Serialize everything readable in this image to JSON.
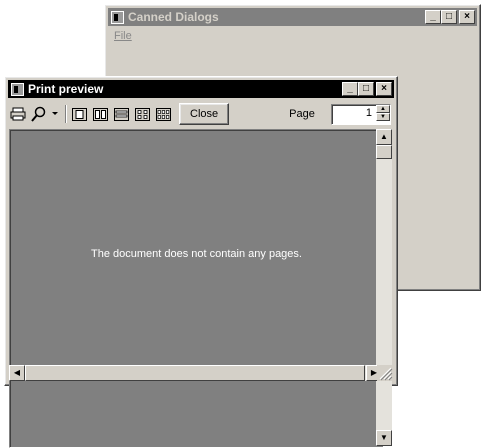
{
  "background_window": {
    "title": "Canned Dialogs",
    "menu": [
      "File"
    ],
    "caption_buttons": [
      "_",
      "□",
      "×"
    ]
  },
  "preview_window": {
    "title": "Print preview",
    "caption_buttons": [
      "_",
      "□",
      "×"
    ],
    "toolbar": {
      "icons": [
        "print-icon",
        "zoom-icon",
        "dropdown-arrow-icon",
        "one-page-icon",
        "two-pages-icon",
        "three-pages-icon",
        "four-pages-icon",
        "six-pages-icon"
      ],
      "close_label": "Close",
      "page_label": "Page",
      "page_value": "1"
    },
    "message": "The document does not contain any pages."
  },
  "colors": {
    "desktop": "#ffffff",
    "window_face": "#d4d0c8",
    "active_title": "#000000",
    "inactive_title": "#808080",
    "preview_area": "#808080"
  }
}
